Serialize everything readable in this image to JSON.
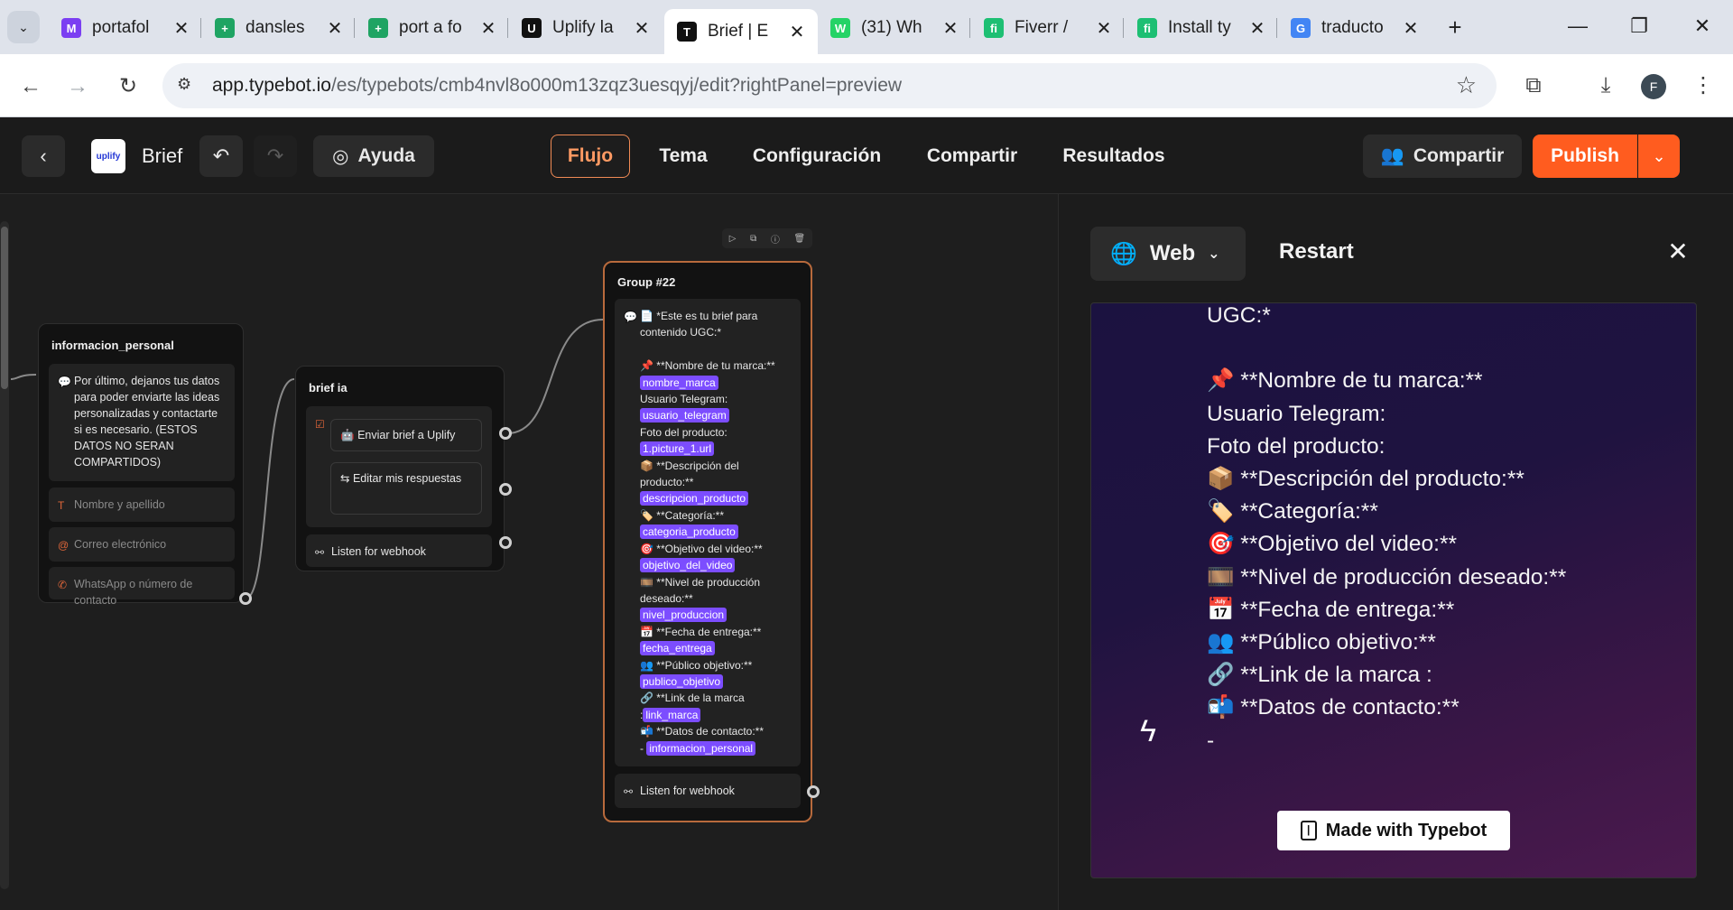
{
  "browser": {
    "tabs": [
      {
        "title": "portafol",
        "favicon": "M",
        "color": "#7b3ff2"
      },
      {
        "title": "dansles",
        "favicon": "+",
        "color": "#1fa463"
      },
      {
        "title": "port a fo",
        "favicon": "+",
        "color": "#1fa463"
      },
      {
        "title": "Uplify la",
        "favicon": "U",
        "color": "#111111"
      },
      {
        "title": "Brief | E",
        "favicon": "T",
        "color": "#111111"
      },
      {
        "title": "(31) Wh",
        "favicon": "W",
        "color": "#25d366"
      },
      {
        "title": "Fiverr /",
        "favicon": "fi",
        "color": "#1dbf73"
      },
      {
        "title": "Install ty",
        "favicon": "fi",
        "color": "#1dbf73"
      },
      {
        "title": "traducto",
        "favicon": "G",
        "color": "#4285f4"
      }
    ],
    "active_tab_index": 4,
    "url_host": "app.typebot.io",
    "url_path": "/es/typebots/cmb4nvl8o000m13zqz3uesqyj/edit?rightPanel=preview",
    "profile_initial": "F"
  },
  "header": {
    "logo_text": "uplify",
    "bot_name": "Brief",
    "help_label": "Ayuda",
    "tabs": [
      "Flujo",
      "Tema",
      "Configuración",
      "Compartir",
      "Resultados"
    ],
    "active_tab": "Flujo",
    "share_label": "Compartir",
    "publish_label": "Publish"
  },
  "canvas": {
    "group_info": {
      "title": "informacion_personal",
      "message": "Por último, dejanos tus datos para poder enviarte las ideas personalizadas y contactarte si es necesario. (ESTOS DATOS NO SERAN COMPARTIDOS)",
      "inputs": [
        "Nombre y apellido",
        "Correo electrónico",
        "WhatsApp o número de contacto"
      ]
    },
    "group_brief": {
      "title": "brief ia",
      "choices": [
        "Enviar brief a Uplify",
        "Editar mis respuestas"
      ],
      "webhook": "Listen for webhook"
    },
    "group_22": {
      "title": "Group #22",
      "lines": [
        {
          "t": "📄 *Este es tu brief para"
        },
        {
          "t": "contenido UGC:*"
        },
        {
          "t": ""
        },
        {
          "t": "📌 **Nombre de tu marca:**"
        },
        {
          "v": "nombre_marca"
        },
        {
          "t": "Usuario Telegram:"
        },
        {
          "v": "usuario_telegram"
        },
        {
          "t": "Foto del producto:"
        },
        {
          "v": "1.picture_1.url"
        },
        {
          "t": "📦 **Descripción del"
        },
        {
          "t": "producto:**"
        },
        {
          "v": "descripcion_producto"
        },
        {
          "t": "🏷️ **Categoría:**"
        },
        {
          "v": "categoria_producto"
        },
        {
          "t": "🎯 **Objetivo del video:**"
        },
        {
          "v": "objetivo_del_video"
        },
        {
          "t": "🎞️ **Nivel de producción"
        },
        {
          "t": "deseado:**"
        },
        {
          "v": "nivel_produccion"
        },
        {
          "t": "📅 **Fecha de entrega:**"
        },
        {
          "v": "fecha_entrega"
        },
        {
          "t": "👥 **Público objetivo:**"
        },
        {
          "v": "publico_objetivo"
        },
        {
          "t": "🔗 **Link de la marca"
        },
        {
          "t": ":",
          "v": "link_marca"
        },
        {
          "t": "📬 **Datos de contacto:**"
        },
        {
          "t": "- ",
          "v": "informacion_personal"
        }
      ],
      "webhook": "Listen for webhook"
    }
  },
  "preview": {
    "mode_label": "Web",
    "restart_label": "Restart",
    "chat_lines": [
      "UGC:*",
      "",
      "📌 **Nombre de tu marca:**",
      "Usuario Telegram:",
      "Foto del producto:",
      "📦 **Descripción del producto:**",
      "🏷️ **Categoría:**",
      "🎯 **Objetivo del video:**",
      "🎞️ **Nivel de producción deseado:**",
      "📅 **Fecha de entrega:**",
      "👥 **Público objetivo:**",
      "🔗 **Link de la marca :",
      "📬 **Datos de contacto:**",
      "-"
    ],
    "made_with_label": "Made with Typebot"
  }
}
